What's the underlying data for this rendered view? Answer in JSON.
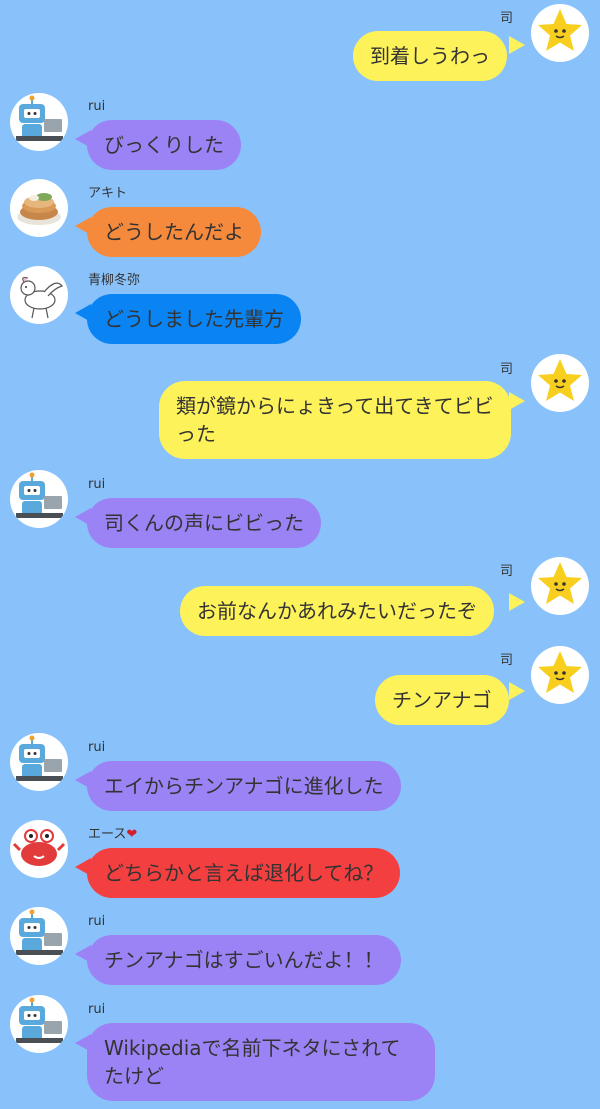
{
  "messages": [
    {
      "id": 0,
      "side": "out",
      "sender": "司",
      "text": "到着しうわっ",
      "avatar": "star-avatar",
      "color": "#fdf25a"
    },
    {
      "id": 1,
      "side": "in",
      "sender": "rui",
      "text": "びっくりした",
      "avatar": "robot-avatar",
      "color": "#9b83f5"
    },
    {
      "id": 2,
      "side": "in",
      "sender": "アキト",
      "text": "どうしたんだよ",
      "avatar": "pancake-avatar",
      "color": "#f58a3d"
    },
    {
      "id": 3,
      "side": "in",
      "sender": "青柳冬弥",
      "text": "どうしました先輩方",
      "avatar": "pegasus-avatar",
      "color": "#0a84f2"
    },
    {
      "id": 4,
      "side": "out",
      "sender": "司",
      "text": "類が鏡からにょきって出てきてビビった",
      "avatar": "star-avatar",
      "color": "#fdf25a"
    },
    {
      "id": 5,
      "side": "in",
      "sender": "rui",
      "text": "司くんの声にビビった",
      "avatar": "robot-avatar",
      "color": "#9b83f5"
    },
    {
      "id": 6,
      "side": "out",
      "sender": "司",
      "text": "お前なんかあれみたいだったぞ",
      "avatar": "star-avatar",
      "color": "#fdf25a"
    },
    {
      "id": 7,
      "side": "out",
      "sender": "司",
      "text": "チンアナゴ",
      "avatar": "star-avatar",
      "color": "#fdf25a"
    },
    {
      "id": 8,
      "side": "in",
      "sender": "rui",
      "text": "エイからチンアナゴに進化した",
      "avatar": "robot-avatar",
      "color": "#9b83f5"
    },
    {
      "id": 9,
      "side": "in",
      "sender": "エース",
      "sender_suffix": "❤",
      "text": "どちらかと言えば退化してね？",
      "avatar": "crab-avatar",
      "color": "#f33f3f"
    },
    {
      "id": 10,
      "side": "in",
      "sender": "rui",
      "text": "チンアナゴはすごいんだよ！！",
      "avatar": "robot-avatar",
      "color": "#9b83f5"
    },
    {
      "id": 11,
      "side": "in",
      "sender": "rui",
      "text": "Wikipediaで名前下ネタにされてたけど",
      "avatar": "robot-avatar",
      "color": "#9b83f5"
    }
  ]
}
